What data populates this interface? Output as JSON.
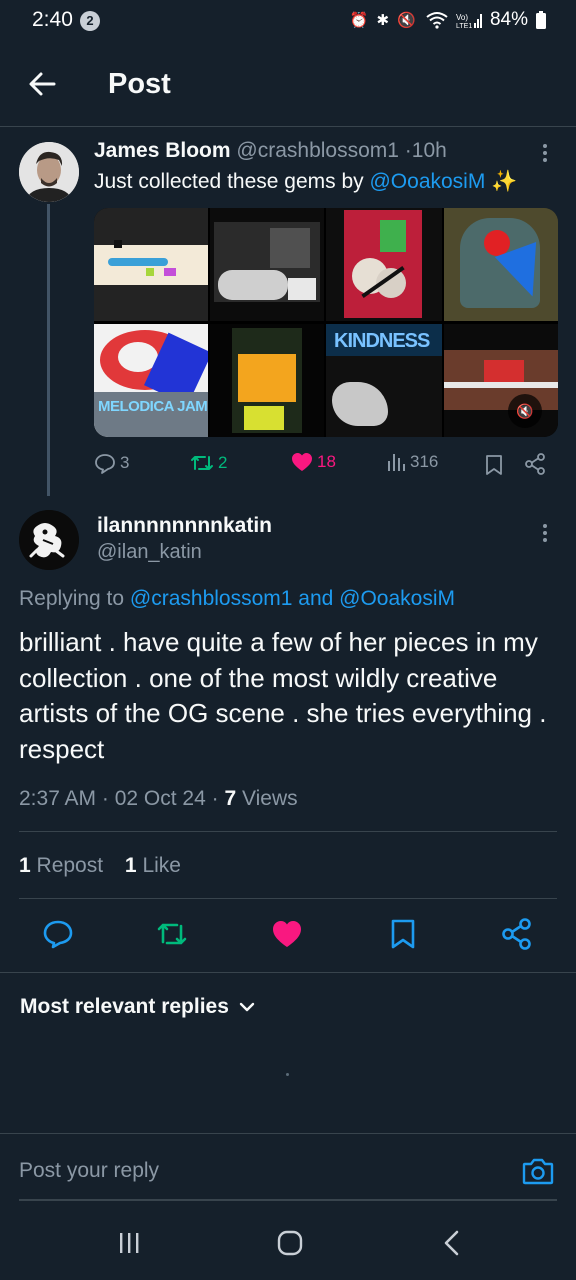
{
  "status_bar": {
    "time": "2:40",
    "notification_count": "2",
    "battery": "84%"
  },
  "header": {
    "title": "Post"
  },
  "quoted_post": {
    "author_name": "James Bloom",
    "author_handle": "@crashblossom1",
    "separator": "·",
    "time_ago": "10h",
    "text_prefix": "Just collected these gems by",
    "mention": "@OoakosiM",
    "emoji": "✨",
    "media_labels": {
      "melodica": "MELODICA JAM",
      "kindness": "KINDNESS"
    },
    "stats": {
      "replies": "3",
      "reposts": "2",
      "likes": "18",
      "views": "316"
    }
  },
  "reply_post": {
    "author_name": "ilannnnnnnnkatin",
    "author_handle": "@ilan_katin",
    "replying_prefix": "Replying to",
    "replying_to": "@crashblossom1 and @OoakosiM",
    "body": "brilliant . have quite a few of her pieces in my collection . one of the most wildly creative artists of the OG scene . she tries everything . respect",
    "timestamp": "2:37 AM · 02 Oct 24 ·",
    "views_count": "7",
    "views_label": "Views",
    "reposts_count": "1",
    "reposts_label": "Repost",
    "likes_count": "1",
    "likes_label": "Like"
  },
  "replies_sort": {
    "label": "Most relevant replies"
  },
  "composer": {
    "placeholder": "Post your reply"
  },
  "colors": {
    "background": "#15202b",
    "accent": "#1d9bf0",
    "like": "#f91880",
    "repost": "#00ba7c",
    "muted": "#8b98a5"
  }
}
